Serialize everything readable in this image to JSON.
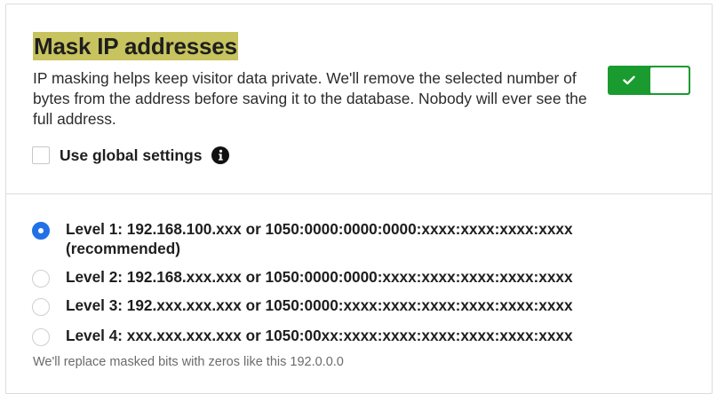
{
  "section": {
    "title": "Mask IP addresses",
    "description": "IP masking helps keep visitor data private. We'll remove the selected number of bytes from the address before saving it to the database. Nobody will ever see the full address.",
    "toggle": {
      "state": "on",
      "on_icon": "check-icon",
      "color": "#1a9b30"
    },
    "global_settings": {
      "label": "Use global settings",
      "checked": false,
      "info_icon": "info-icon"
    }
  },
  "levels": [
    {
      "label": "Level 1: 192.168.100.xxx or 1050:0000:0000:0000:xxxx:xxxx:xxxx:xxxx (recommended)",
      "selected": true
    },
    {
      "label": "Level 2: 192.168.xxx.xxx or 1050:0000:0000:xxxx:xxxx:xxxx:xxxx:xxxx",
      "selected": false
    },
    {
      "label": "Level 3: 192.xxx.xxx.xxx or 1050:0000:xxxx:xxxx:xxxx:xxxx:xxxx:xxxx",
      "selected": false
    },
    {
      "label": "Level 4: xxx.xxx.xxx.xxx or 1050:00xx:xxxx:xxxx:xxxx:xxxx:xxxx:xxxx",
      "selected": false
    }
  ],
  "hint": "We'll replace masked bits with zeros like this 192.0.0.0",
  "colors": {
    "title_highlight": "#c7c35e",
    "radio_selected": "#2271e6"
  }
}
